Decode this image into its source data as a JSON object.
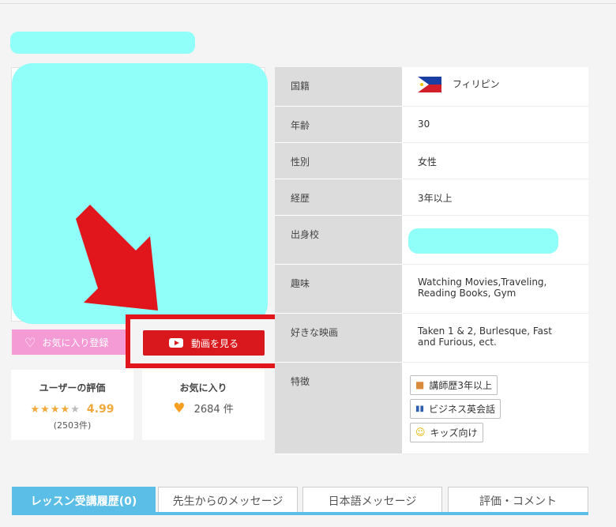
{
  "favorite_button": {
    "label": "お気に入り登録",
    "icon": "heart-outline-icon"
  },
  "video_button": {
    "label": "動画を見る",
    "icon": "play-icon"
  },
  "rating_card": {
    "title": "ユーザーの評価",
    "score": "4.99",
    "count": "(2503件)"
  },
  "favorites_card": {
    "title": "お気に入り",
    "count": "2684 件"
  },
  "profile": {
    "nationality": {
      "key": "国籍",
      "value": "フィリピン"
    },
    "age": {
      "key": "年齢",
      "value": "30"
    },
    "gender": {
      "key": "性別",
      "value": "女性"
    },
    "experience": {
      "key": "経歴",
      "value": "3年以上"
    },
    "school": {
      "key": "出身校"
    },
    "hobby": {
      "key": "趣味",
      "value": "Watching Movies,Traveling, Reading Books, Gym"
    },
    "movie": {
      "key": "好きな映画",
      "value": "Taken 1 & 2, Burlesque, Fast and Furious, ect."
    },
    "features": {
      "key": "特徴",
      "tags": [
        "講師歴3年以上",
        "ビジネス英会話",
        "キッズ向け"
      ]
    }
  },
  "tabs": [
    "レッスン受講履歴(0)",
    "先生からのメッセージ",
    "日本語メッセージ",
    "評価・コメント"
  ],
  "colors": {
    "accent_blue": "#5bbee6",
    "video_red": "#d9181e",
    "favorite_pink": "#f49ad5",
    "star_orange": "#f2a93b",
    "redaction": "#91fff9"
  }
}
